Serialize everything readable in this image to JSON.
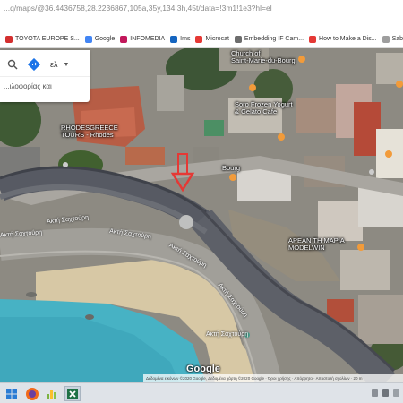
{
  "browser": {
    "url_prefix": "...q/maps/",
    "url": "@36.4436758,28.2236867,105a,35y,134.3h,45t/data=!3m1!1e3?hl=el"
  },
  "bookmarks": [
    {
      "label": "TOYOTA EUROPE S...",
      "icon": "toyota-icon",
      "color": "#d32f2f"
    },
    {
      "label": "Google",
      "icon": "google-icon",
      "color": "#4285f4"
    },
    {
      "label": "INFOMEDIA",
      "icon": "infomedia-icon",
      "color": "#c2185b"
    },
    {
      "label": "Ims",
      "icon": "ims-icon",
      "color": "#1565c0"
    },
    {
      "label": "Microcat",
      "icon": "microcat-icon",
      "color": "#e53935"
    },
    {
      "label": "Embedding IF Cam...",
      "icon": "embed-icon",
      "color": "#6d6d6d"
    },
    {
      "label": "How to Make a Dis...",
      "icon": "youtube-icon",
      "color": "#e53935"
    },
    {
      "label": "Saba: SumaaSource &...",
      "icon": "saba-icon",
      "color": "#9e9e9e"
    }
  ],
  "search_panel": {
    "search_icon": "search-icon",
    "directions_icon": "directions-icon",
    "language": "ελ",
    "second_line": "...ιλοφορίας και"
  },
  "map_labels": {
    "rhodes_greece": "RHODESGREECE\nTOURS - Rhodes",
    "church": "Church of\nSaint-Marie-du-Bourg",
    "soro": "Soro Frozen Yogurt\n& Gelato Cafe",
    "bourg": "Bourg",
    "arean": "ΑΡΕΑΝ ΤΗ ΜΑΡΙΑ\nMODELWIN"
  },
  "road_labels": [
    "Ακτή Σαχτούρη",
    "Ακτή Σαχτούρη",
    "Ακτή Σαχτούρη",
    "Ακτή Σαχτούρη",
    "Ακτή Σαχτούρη",
    "Ακτή Σαχτούρη"
  ],
  "map_footer": {
    "google_logo": "Google",
    "attribution": "Δεδομένα εικόνων ©2020 Google, Δεδομένα χάρτη ©2020 Google · Όροι χρήσης · Απόρρητο · Αποστολή σχολίων · 20 m"
  },
  "taskbar": {
    "apps": [
      "firefox-icon",
      "chart-icon",
      "excel-icon"
    ]
  },
  "colors": {
    "sea": "#4fb6c6",
    "sand": "#d8c9a7",
    "wall": "#5b5e66",
    "road": "#9a9a96",
    "pin": "#e53935"
  }
}
